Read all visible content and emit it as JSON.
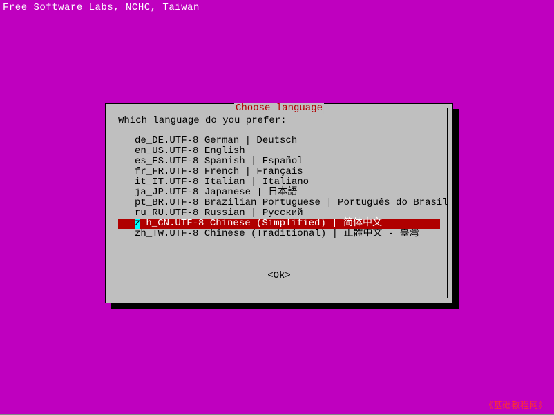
{
  "header": "Free Software Labs, NCHC, Taiwan",
  "dialog": {
    "title": " Choose language ",
    "prompt": "Which language do you prefer:",
    "ok_label": "<Ok>"
  },
  "languages": [
    {
      "label": "de_DE.UTF-8 German | Deutsch",
      "selected": false
    },
    {
      "label": "en_US.UTF-8 English",
      "selected": false
    },
    {
      "label": "es_ES.UTF-8 Spanish | Español",
      "selected": false
    },
    {
      "label": "fr_FR.UTF-8 French | Français",
      "selected": false
    },
    {
      "label": "it_IT.UTF-8 Italian | Italiano",
      "selected": false
    },
    {
      "label": "ja_JP.UTF-8 Japanese | 日本語",
      "selected": false
    },
    {
      "label": "pt_BR.UTF-8 Brazilian Portuguese | Português do Brasil",
      "selected": false
    },
    {
      "label": "ru_RU.UTF-8 Russian | Русский",
      "selected": false
    },
    {
      "label": "zh_CN.UTF-8 Chinese (Simplified) | 简体中文",
      "selected": true
    },
    {
      "label": "zh_TW.UTF-8 Chinese (Traditional) | 正體中文 - 臺灣",
      "selected": false
    }
  ],
  "footer": "《基础教程网》"
}
